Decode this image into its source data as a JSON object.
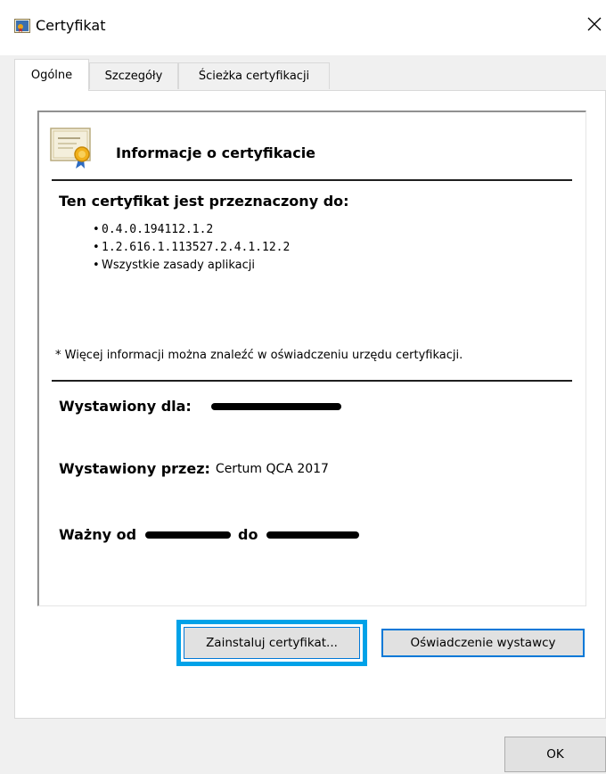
{
  "window": {
    "title": "Certyfikat",
    "close_glyph": "✕"
  },
  "tabs": [
    {
      "label": "Ogólne",
      "active": true
    },
    {
      "label": "Szczegóły",
      "active": false
    },
    {
      "label": "Ścieżka certyfikacji",
      "active": false
    }
  ],
  "info": {
    "title": "Informacje o certyfikacie",
    "purpose_heading": "Ten certyfikat jest przeznaczony do:",
    "purposes": [
      "0.4.0.194112.1.2",
      "1.2.616.1.113527.2.4.1.12.2",
      "Wszystkie zasady aplikacji"
    ],
    "note": "* Więcej informacji można znaleźć w oświadczeniu urzędu certyfikacji.",
    "issued_to_label": "Wystawiony dla:",
    "issued_by_label": "Wystawiony przez:",
    "issued_by_value": "Certum QCA 2017",
    "valid_from_label": "Ważny od",
    "valid_to_label": "do"
  },
  "buttons": {
    "install": "Zainstaluj certyfikat...",
    "issuer_statement": "Oświadczenie wystawcy",
    "ok": "OK"
  },
  "colors": {
    "focus_ring": "#00a2e8",
    "button_border_accent": "#0078d7",
    "dialog_background": "#f0f0f0"
  },
  "icons": {
    "title": "certificate-icon",
    "info": "certificate-large-icon",
    "close": "close-icon"
  }
}
